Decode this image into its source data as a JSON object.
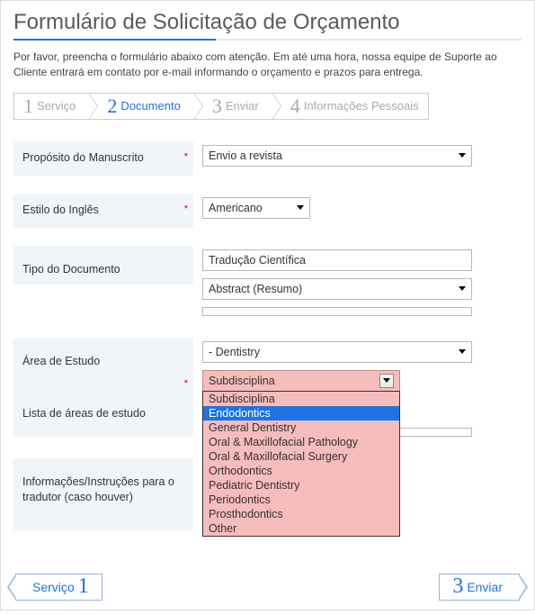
{
  "title": "Formulário de Solicitação de Orçamento",
  "intro": "Por favor, preencha o formulário abaixo com atenção. Em até uma hora, nossa equipe de Suporte ao Cliente entrará em contato por e-mail informando o orçamento e prazos para entrega.",
  "steps": [
    {
      "num": "1",
      "label": "Serviço",
      "active": false
    },
    {
      "num": "2",
      "label": "Documento",
      "active": true
    },
    {
      "num": "3",
      "label": "Enviar",
      "active": false
    },
    {
      "num": "4",
      "label": "Informações Pessoais",
      "active": false
    }
  ],
  "fields": {
    "purpose": {
      "label": "Propósito do Manuscrito",
      "required": true,
      "value": "Envio a revista"
    },
    "english": {
      "label": "Estilo do Inglês",
      "required": true,
      "value": "Americano"
    },
    "doctype": {
      "label": "Tipo do Documento",
      "required": false,
      "text1": "Tradução Científica",
      "value": "Abstract (Resumo)",
      "text2": ""
    },
    "study": {
      "label": "Área de Estudo",
      "required": true,
      "value": "- Dentistry"
    },
    "sub": {
      "selected": "Subdisciplina",
      "options": [
        "Subdisciplina",
        "Endodontics",
        "General Dentistry",
        "Oral & Maxillofacial Pathology",
        "Oral & Maxillofacial Surgery",
        "Orthodontics",
        "Pediatric Dentistry",
        "Periodontics",
        "Prosthodontics",
        "Other"
      ],
      "highlight_index": 1
    },
    "studylist": {
      "label": "Lista de áreas de estudo",
      "value": ""
    },
    "instructions": {
      "label": "Informações/Instruções para o tradutor (caso houver)",
      "value": ""
    }
  },
  "nav": {
    "prev": {
      "num": "1",
      "label": "Serviço"
    },
    "next": {
      "num": "3",
      "label": "Enviar"
    }
  }
}
